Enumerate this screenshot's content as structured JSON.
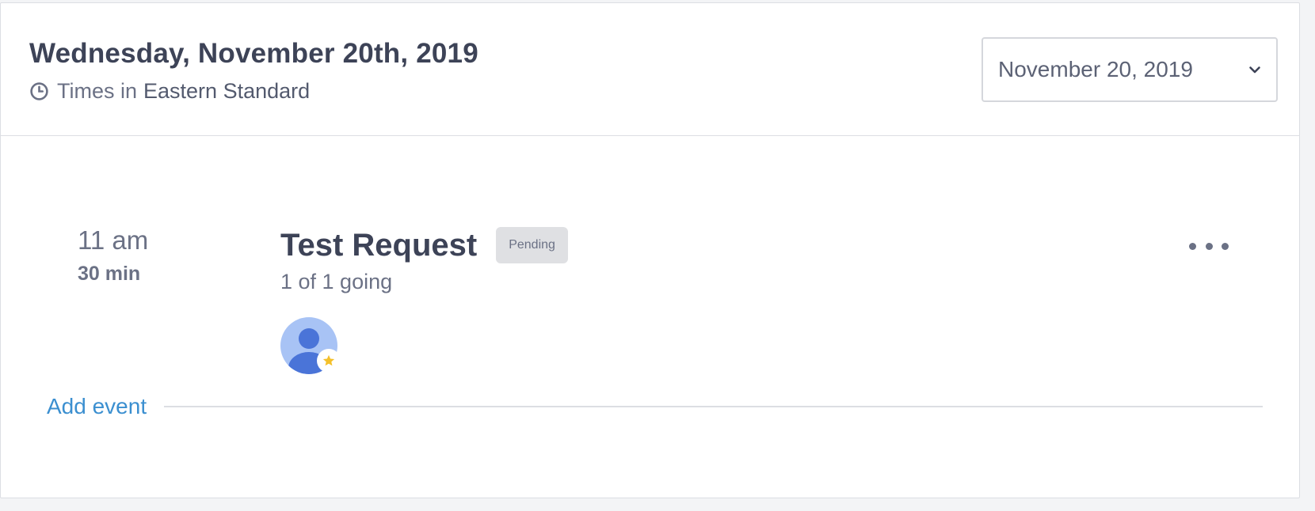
{
  "header": {
    "date_title": "Wednesday, November 20th, 2019",
    "timezone_prefix": "Times in",
    "timezone_name": "Eastern Standard",
    "date_select_value": "November 20, 2019"
  },
  "event": {
    "start_time": "11 am",
    "duration": "30 min",
    "title": "Test Request",
    "status_badge": "Pending",
    "attendance": "1 of 1 going"
  },
  "actions": {
    "add_event_label": "Add event"
  },
  "icons": {
    "clock": "clock-icon",
    "chevron": "chevron-down-icon",
    "more": "more-horizontal-icon",
    "avatar": "user-avatar-icon",
    "star": "star-icon"
  },
  "colors": {
    "title_text": "#3d4357",
    "muted_text": "#6b7185",
    "link": "#3b8fd0",
    "badge_bg": "#dfe0e3",
    "avatar_bg": "#a8c3f5",
    "avatar_fg": "#4a74d8",
    "star": "#f4c02a"
  }
}
